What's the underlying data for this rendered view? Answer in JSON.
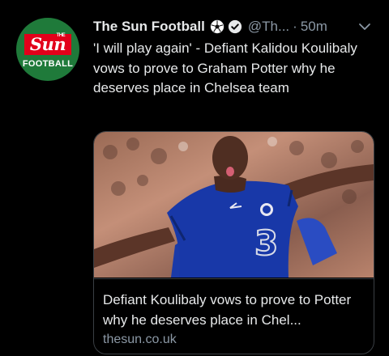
{
  "tweet": {
    "avatar": {
      "brand_small": "THE",
      "brand_top": "Sun",
      "brand_bottom": "FOOTBALL"
    },
    "display_name": "The Sun Football",
    "handle": "@Th...",
    "separator": "·",
    "time": "50m",
    "text": "'I will play again' - Defiant Kalidou Koulibaly vows to prove to Graham Potter why he deserves place in Chelsea team",
    "card": {
      "title": "Defiant Koulibaly vows to prove to Potter why he deserves place in Chel...",
      "domain": "thesun.co.uk"
    }
  },
  "colors": {
    "background": "#000000",
    "text": "#e7e9ea",
    "muted": "#8b98a5",
    "brand_red": "#e2001a",
    "avatar_green": "#1f7a3a",
    "chelsea_blue": "#1838a8"
  },
  "icons": [
    "soccer-ball-icon",
    "verified-badge-icon",
    "chevron-down-icon",
    "image-photo"
  ]
}
